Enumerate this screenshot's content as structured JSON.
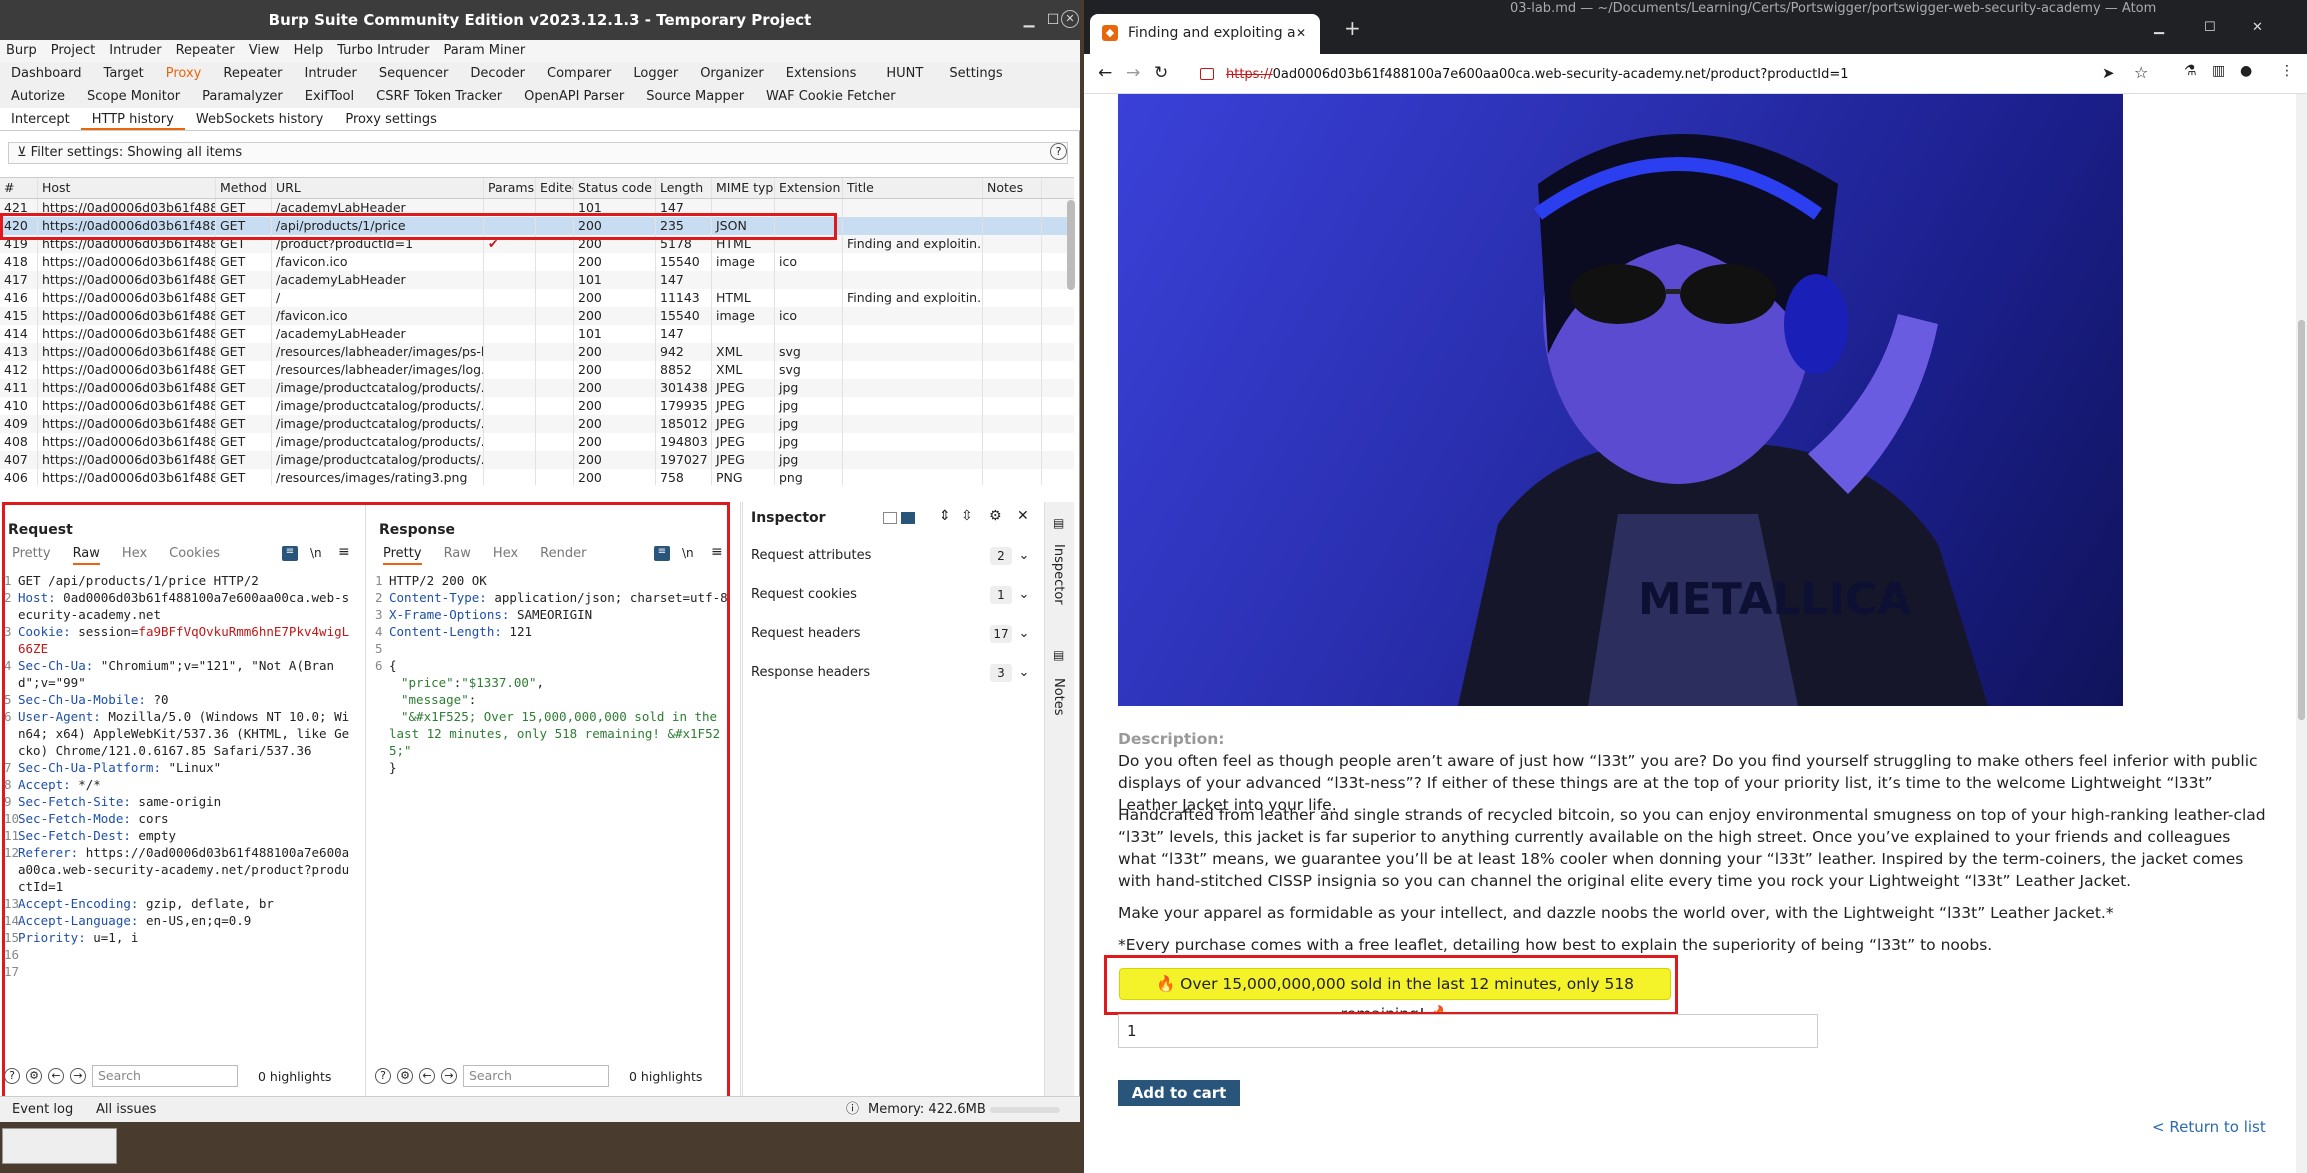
{
  "burp": {
    "title": "Burp Suite Community Edition v2023.12.1.3 - Temporary Project",
    "menu": [
      "Burp",
      "Project",
      "Intruder",
      "Repeater",
      "View",
      "Help",
      "Turbo Intruder",
      "Param Miner"
    ],
    "tabs_row1": [
      "Dashboard",
      "Target",
      "Proxy",
      "Repeater",
      "Intruder",
      "Sequencer",
      "Decoder",
      "Comparer",
      "Logger",
      "Organizer",
      "Extensions",
      "HUNT",
      "Settings"
    ],
    "tabs_row2": [
      "Autorize",
      "Scope Monitor",
      "Paramalyzer",
      "ExifTool",
      "CSRF Token Tracker",
      "OpenAPI Parser",
      "Source Mapper",
      "WAF Cookie Fetcher"
    ],
    "subtabs": [
      "Intercept",
      "HTTP history",
      "WebSockets history",
      "Proxy settings"
    ],
    "filter": "Filter settings: Showing all items",
    "history": {
      "columns": [
        "#",
        "Host",
        "Method",
        "URL",
        "Params",
        "Edited",
        "Status code",
        "Length",
        "MIME type",
        "Extension",
        "Title",
        "Notes"
      ],
      "rows": [
        [
          "421",
          "https://0ad0006d03b61f488...",
          "GET",
          "/academyLabHeader",
          "",
          "",
          "101",
          "147",
          "",
          "",
          "",
          ""
        ],
        [
          "420",
          "https://0ad0006d03b61f488...",
          "GET",
          "/api/products/1/price",
          "",
          "",
          "200",
          "235",
          "JSON",
          "",
          "",
          ""
        ],
        [
          "419",
          "https://0ad0006d03b61f488...",
          "GET",
          "/product?productId=1",
          "✔",
          "",
          "200",
          "5178",
          "HTML",
          "",
          "Finding and exploitin...",
          ""
        ],
        [
          "418",
          "https://0ad0006d03b61f488...",
          "GET",
          "/favicon.ico",
          "",
          "",
          "200",
          "15540",
          "image",
          "ico",
          "",
          ""
        ],
        [
          "417",
          "https://0ad0006d03b61f488...",
          "GET",
          "/academyLabHeader",
          "",
          "",
          "101",
          "147",
          "",
          "",
          "",
          ""
        ],
        [
          "416",
          "https://0ad0006d03b61f488...",
          "GET",
          "/",
          "",
          "",
          "200",
          "11143",
          "HTML",
          "",
          "Finding and exploitin...",
          ""
        ],
        [
          "415",
          "https://0ad0006d03b61f488...",
          "GET",
          "/favicon.ico",
          "",
          "",
          "200",
          "15540",
          "image",
          "ico",
          "",
          ""
        ],
        [
          "414",
          "https://0ad0006d03b61f488...",
          "GET",
          "/academyLabHeader",
          "",
          "",
          "101",
          "147",
          "",
          "",
          "",
          ""
        ],
        [
          "413",
          "https://0ad0006d03b61f488...",
          "GET",
          "/resources/labheader/images/ps-l...",
          "",
          "",
          "200",
          "942",
          "XML",
          "svg",
          "",
          ""
        ],
        [
          "412",
          "https://0ad0006d03b61f488...",
          "GET",
          "/resources/labheader/images/log...",
          "",
          "",
          "200",
          "8852",
          "XML",
          "svg",
          "",
          ""
        ],
        [
          "411",
          "https://0ad0006d03b61f488...",
          "GET",
          "/image/productcatalog/products/...",
          "",
          "",
          "200",
          "301438",
          "JPEG",
          "jpg",
          "",
          ""
        ],
        [
          "410",
          "https://0ad0006d03b61f488...",
          "GET",
          "/image/productcatalog/products/...",
          "",
          "",
          "200",
          "179935",
          "JPEG",
          "jpg",
          "",
          ""
        ],
        [
          "409",
          "https://0ad0006d03b61f488...",
          "GET",
          "/image/productcatalog/products/...",
          "",
          "",
          "200",
          "185012",
          "JPEG",
          "jpg",
          "",
          ""
        ],
        [
          "408",
          "https://0ad0006d03b61f488...",
          "GET",
          "/image/productcatalog/products/...",
          "",
          "",
          "200",
          "194803",
          "JPEG",
          "jpg",
          "",
          ""
        ],
        [
          "407",
          "https://0ad0006d03b61f488...",
          "GET",
          "/image/productcatalog/products/...",
          "",
          "",
          "200",
          "197027",
          "JPEG",
          "jpg",
          "",
          ""
        ],
        [
          "406",
          "https://0ad0006d03b61f488...",
          "GET",
          "/resources/images/rating3.png",
          "",
          "",
          "200",
          "758",
          "PNG",
          "png",
          "",
          ""
        ]
      ]
    },
    "request": {
      "title": "Request",
      "tabs": [
        "Pretty",
        "Raw",
        "Hex",
        "Cookies"
      ],
      "lines": [
        {
          "n": "1",
          "t": "GET /api/products/1/price HTTP/2"
        },
        {
          "n": "2",
          "k": "Host:",
          "t": " 0ad0006d03b61f488100a7e600aa00ca.web-security-academy.net"
        },
        {
          "n": "3",
          "k": "Cookie:",
          "t": " session=",
          "r": "fa9BFfVqOvkuRmm6hnE7Pkv4wigL66ZE"
        },
        {
          "n": "4",
          "k": "Sec-Ch-Ua:",
          "t": " \"Chromium\";v=\"121\", \"Not A(Brand\";v=\"99\""
        },
        {
          "n": "5",
          "k": "Sec-Ch-Ua-Mobile:",
          "t": " ?0"
        },
        {
          "n": "6",
          "k": "User-Agent:",
          "t": " Mozilla/5.0 (Windows NT 10.0; Win64; x64) AppleWebKit/537.36 (KHTML, like Gecko) Chrome/121.0.6167.85 Safari/537.36"
        },
        {
          "n": "7",
          "k": "Sec-Ch-Ua-Platform:",
          "t": " \"Linux\""
        },
        {
          "n": "8",
          "k": "Accept:",
          "t": " */*"
        },
        {
          "n": "9",
          "k": "Sec-Fetch-Site:",
          "t": " same-origin"
        },
        {
          "n": "10",
          "k": "Sec-Fetch-Mode:",
          "t": " cors"
        },
        {
          "n": "11",
          "k": "Sec-Fetch-Dest:",
          "t": " empty"
        },
        {
          "n": "12",
          "k": "Referer:",
          "t": " https://0ad0006d03b61f488100a7e600aa00ca.web-security-academy.net/product?productId=1"
        },
        {
          "n": "13",
          "k": "Accept-Encoding:",
          "t": " gzip, deflate, br"
        },
        {
          "n": "14",
          "k": "Accept-Language:",
          "t": " en-US,en;q=0.9"
        },
        {
          "n": "15",
          "k": "Priority:",
          "t": " u=1, i"
        },
        {
          "n": "16",
          "t": ""
        },
        {
          "n": "17",
          "t": ""
        }
      ],
      "search_placeholder": "Search",
      "highlights": "0 highlights"
    },
    "response": {
      "title": "Response",
      "tabs": [
        "Pretty",
        "Raw",
        "Hex",
        "Render"
      ],
      "lines": [
        {
          "n": "1",
          "t": "HTTP/2 200 OK"
        },
        {
          "n": "2",
          "k": "Content-Type:",
          "t": " application/json; charset=utf-8"
        },
        {
          "n": "3",
          "k": "X-Frame-Options:",
          "t": " SAMEORIGIN"
        },
        {
          "n": "4",
          "k": "Content-Length:",
          "t": " 121"
        },
        {
          "n": "5",
          "t": ""
        },
        {
          "n": "6",
          "t": "{"
        },
        {
          "n": "",
          "g": "\"price\"",
          "t": ":",
          "r": "\"$1337.00\"",
          "e": ","
        },
        {
          "n": "",
          "g": "\"message\"",
          "t": ":"
        },
        {
          "n": "",
          "g": "\"&#x1F525; Over 15,000,000,000 sold in the last 12 minutes, only 518 remaining! &#x1F525;\""
        },
        {
          "n": "",
          "t": "}"
        }
      ],
      "search_placeholder": "Search",
      "highlights": "0 highlights"
    },
    "inspector": {
      "title": "Inspector",
      "sections": [
        {
          "label": "Request attributes",
          "count": "2"
        },
        {
          "label": "Request cookies",
          "count": "1"
        },
        {
          "label": "Request headers",
          "count": "17"
        },
        {
          "label": "Response headers",
          "count": "3"
        }
      ],
      "side_tabs": [
        "Inspector",
        "Notes"
      ]
    },
    "status": {
      "event_log": "Event log",
      "all_issues": "All issues",
      "memory": "Memory: 422.6MB"
    }
  },
  "browser": {
    "tab_title": "Finding and exploiting a",
    "window_title": "03-lab.md — ~/Documents/Learning/Certs/Portswigger/portswigger-web-security-academy — Atom",
    "url_scheme": "https://",
    "url_rest": "0ad0006d03b61f488100a7e600aa00ca.web-security-academy.net/product?productId=1",
    "shirt_text": "METALLICA",
    "description_label": "Description:",
    "paragraphs": [
      "Do you often feel as though people aren’t aware of just how “l33t” you are? Do you find yourself struggling to make others feel inferior with public displays of your advanced “l33t-ness”? If either of these things are at the top of your priority list, it’s time to the welcome Lightweight “l33t” Leather Jacket into your life.",
      "Handcrafted from leather and single strands of recycled bitcoin, so you can enjoy environmental smugness on top of your high-ranking leather-clad “l33t” levels, this jacket is far superior to anything currently available on the high street. Once you’ve explained to your friends and colleagues what “l33t” means, we guarantee you’ll be at least 18% cooler when donning your “l33t” leather. Inspired by the term-coiners, the jacket comes with hand-stitched CISSP insignia so you can channel the original elite every time you rock your Lightweight “l33t” Leather Jacket.",
      "Make your apparel as formidable as your intellect, and dazzle noobs the world over, with the Lightweight “l33t” Leather Jacket.*",
      "*Every purchase comes with a free leaflet, detailing how best to explain the superiority of being “l33t” to noobs."
    ],
    "banner": "🔥 Over 15,000,000,000 sold in the last 12 minutes, only 518 remaining! 🔥",
    "quantity": "1",
    "add_to_cart": "Add to cart",
    "return_link": "< Return to list"
  }
}
